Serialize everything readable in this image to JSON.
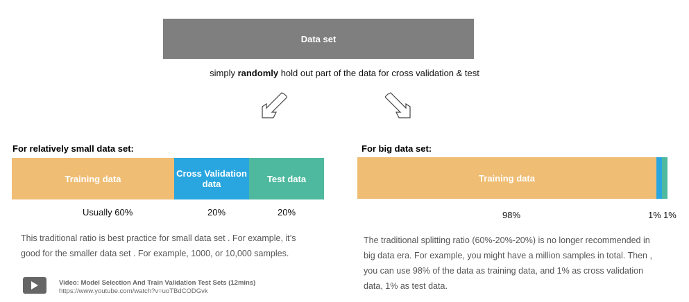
{
  "dataset": {
    "label": "Data set"
  },
  "subtitle": {
    "before": "simply ",
    "bold": "randomly",
    "after": " hold out part of the data for cross validation & test"
  },
  "small": {
    "heading": "For relatively small data set:",
    "training": "Training data",
    "cv_line1": "Cross Validation",
    "cv_line2": "data",
    "test": "Test  data",
    "pct_training": "Usually 60%",
    "pct_cv": "20%",
    "pct_test": "20%",
    "paragraph_line1": "This traditional ratio is best practice for small data set . For example, it’s",
    "paragraph_line2": "good for the smaller data set . For example,  1000, or 10,000 samples."
  },
  "big": {
    "heading": "For big data set:",
    "training": "Training data",
    "pct_training": "98%",
    "pct_cv": "1%",
    "pct_test": "1%",
    "paragraph_line1": "The traditional splitting ratio (60%-20%-20%) is no longer recommended in",
    "paragraph_line2": "big data era. For example, you might have a million samples in total. Then ,",
    "paragraph_line3": "you can use 98% of the data as training data, and 1% as cross validation",
    "paragraph_line4": "data, 1% as test data."
  },
  "video": {
    "title": "Video: Model Selection And Train Validation Test Sets (12mins)",
    "url": "https://www.youtube.com/watch?v=uoTBdCODGvk"
  },
  "colors": {
    "dataset_box": "#7f7f7f",
    "training": "#efbd74",
    "cross_validation": "#29a6df",
    "test": "#4fb99f"
  },
  "icons": [
    "down-left-arrow-icon",
    "down-right-arrow-icon",
    "play-icon"
  ]
}
